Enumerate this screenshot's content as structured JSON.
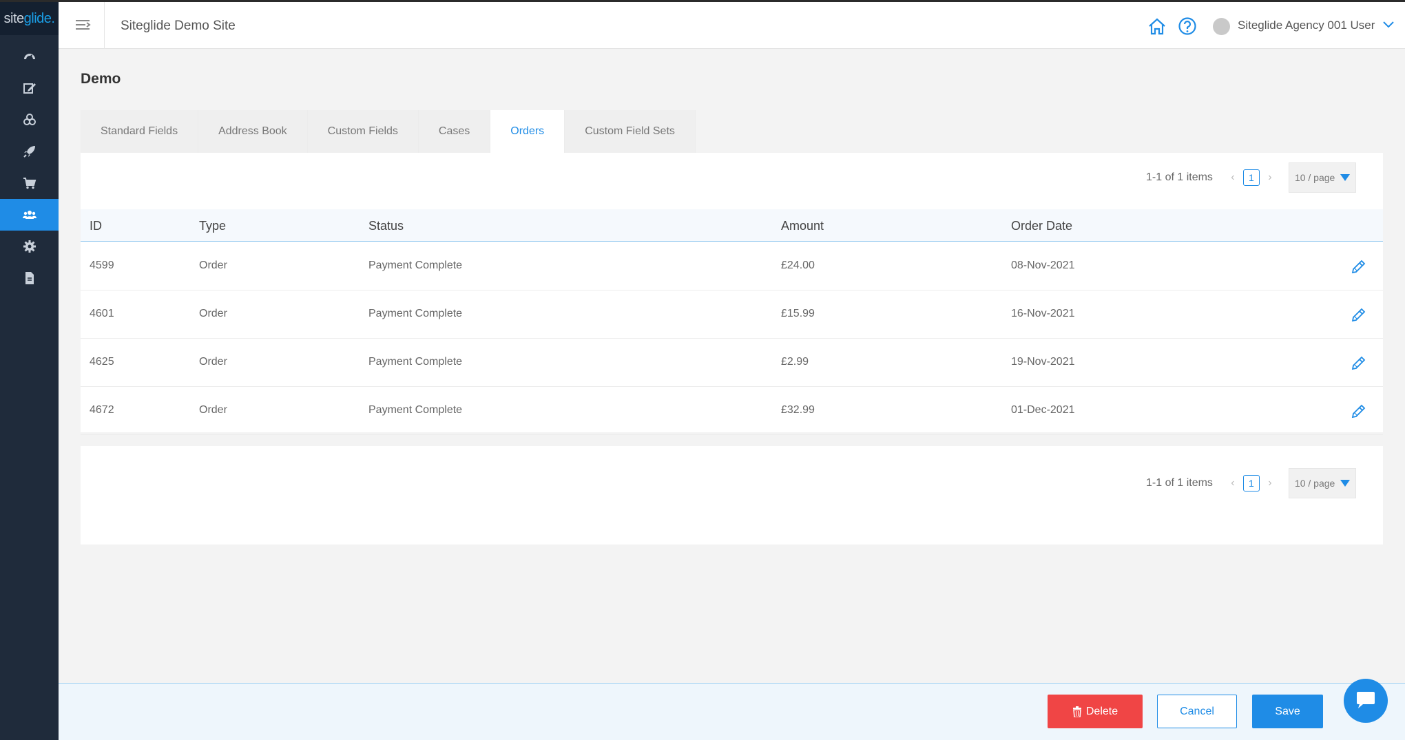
{
  "logo": {
    "prefix": "site",
    "highlight": "glide",
    "suffix": "."
  },
  "sidebar": {
    "items": [
      {
        "icon": "dashboard-icon",
        "active": false
      },
      {
        "icon": "edit-icon",
        "active": false
      },
      {
        "icon": "modules-icon",
        "active": false
      },
      {
        "icon": "rocket-icon",
        "active": false
      },
      {
        "icon": "cart-icon",
        "active": false
      },
      {
        "icon": "users-icon",
        "active": true
      },
      {
        "icon": "gear-icon",
        "active": false
      },
      {
        "icon": "document-icon",
        "active": false
      }
    ]
  },
  "header": {
    "site_title": "Siteglide Demo Site",
    "user_name": "Siteglide Agency 001 User"
  },
  "page": {
    "title": "Demo"
  },
  "tabs": [
    {
      "label": "Standard Fields",
      "active": false
    },
    {
      "label": "Address Book",
      "active": false
    },
    {
      "label": "Custom Fields",
      "active": false
    },
    {
      "label": "Cases",
      "active": false
    },
    {
      "label": "Orders",
      "active": true
    },
    {
      "label": "Custom Field Sets",
      "active": false
    }
  ],
  "pagination": {
    "count": "1-1 of 1 items",
    "page": "1",
    "page_size": "10 / page"
  },
  "table": {
    "headers": {
      "id": "ID",
      "type": "Type",
      "status": "Status",
      "amount": "Amount",
      "date": "Order Date"
    },
    "rows": [
      {
        "id": "4599",
        "type": "Order",
        "status": "Payment Complete",
        "amount": "£24.00",
        "date": "08-Nov-2021"
      },
      {
        "id": "4601",
        "type": "Order",
        "status": "Payment Complete",
        "amount": "£15.99",
        "date": "16-Nov-2021"
      },
      {
        "id": "4625",
        "type": "Order",
        "status": "Payment Complete",
        "amount": "£2.99",
        "date": "19-Nov-2021"
      },
      {
        "id": "4672",
        "type": "Order",
        "status": "Payment Complete",
        "amount": "£32.99",
        "date": "01-Dec-2021"
      }
    ]
  },
  "footer": {
    "delete_label": "Delete",
    "cancel_label": "Cancel",
    "save_label": "Save"
  },
  "colors": {
    "accent": "#1f8ce6",
    "danger": "#f04545",
    "sidebar": "#1f2b3b"
  }
}
